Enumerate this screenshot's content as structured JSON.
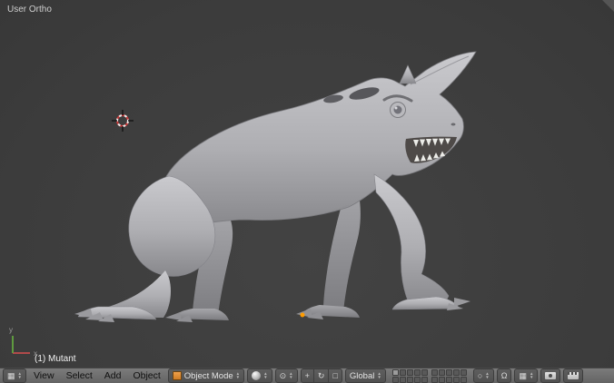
{
  "glyphs": {
    "up": "▲",
    "down": "▼"
  },
  "viewport": {
    "view_label": "User Ortho",
    "object_info": "(1) Mutant",
    "axis": {
      "x": "x",
      "y": "y"
    }
  },
  "header": {
    "editor_type": {
      "glyph": "▦"
    },
    "menus": [
      {
        "label": "View"
      },
      {
        "label": "Select"
      },
      {
        "label": "Add"
      },
      {
        "label": "Object"
      }
    ],
    "mode": {
      "value": "Object Mode"
    },
    "pivot": {
      "glyph": "⊙"
    },
    "manipulators": [
      {
        "name": "translate",
        "glyph": "+"
      },
      {
        "name": "rotate",
        "glyph": "↻"
      },
      {
        "name": "scale",
        "glyph": "□"
      }
    ],
    "orientation": {
      "value": "Global"
    },
    "layers": {
      "groups": 2,
      "rows": 2,
      "cols": 5,
      "active": [
        0
      ]
    },
    "tools": {
      "proportional_glyph": "○",
      "magnet_glyph": "Ω",
      "snap_target_glyph": "▦"
    }
  },
  "colors": {
    "viewport_bg": "#3d3d3d",
    "header_bg": "#6e6e6e",
    "accent_orange": "#ff9c00",
    "model_gray": "#b0b0b4",
    "axis_x_red": "#b04a4a",
    "axis_y_green": "#5f9a3f"
  }
}
